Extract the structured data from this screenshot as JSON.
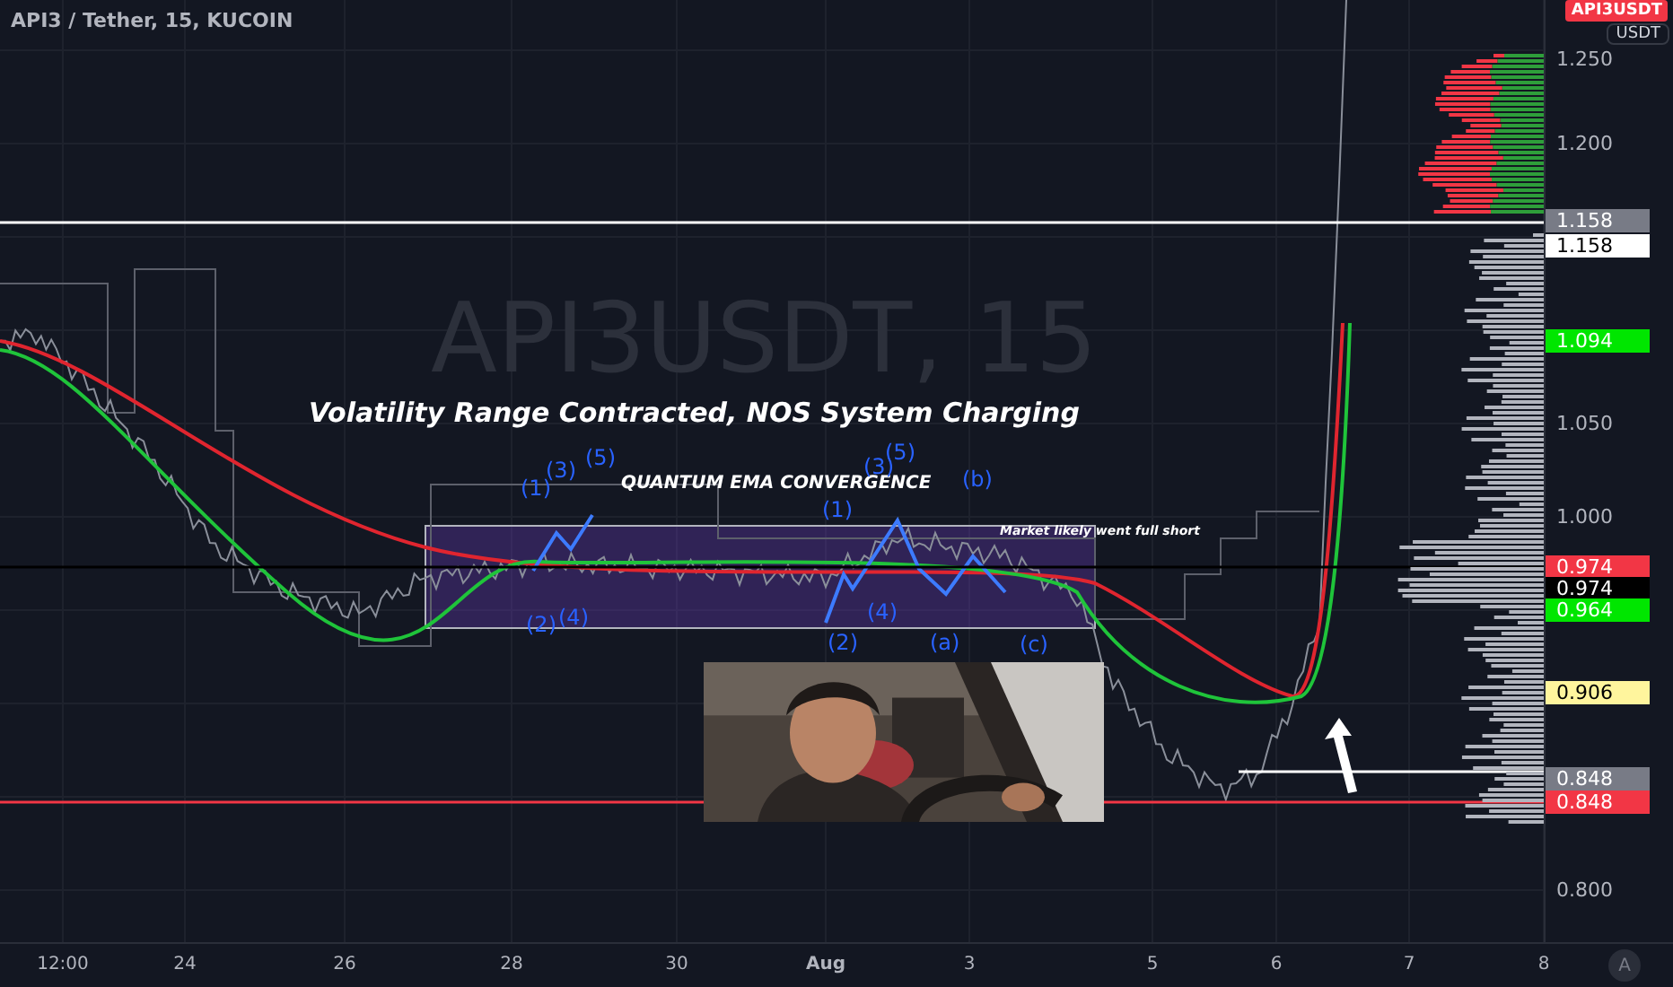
{
  "header": {
    "title": "API3 / Tether, 15, KUCOIN"
  },
  "watermark": "API3USDT, 15",
  "annotations": [
    {
      "kind": "headline",
      "text": "Volatility Range Contracted, NOS System Charging"
    },
    {
      "kind": "subtitle",
      "text": "QUANTUM EMA CONVERGENCE"
    },
    {
      "kind": "note",
      "text": "Market likely went full short"
    },
    {
      "kind": "wave",
      "text": "(1)"
    },
    {
      "kind": "wave",
      "text": "(3)"
    },
    {
      "kind": "wave",
      "text": "(5)"
    },
    {
      "kind": "wave",
      "text": "(3)"
    },
    {
      "kind": "wave",
      "text": "(5)"
    },
    {
      "kind": "wave",
      "text": "(b)"
    },
    {
      "kind": "wave",
      "text": "(1)"
    },
    {
      "kind": "wave",
      "text": "(2)"
    },
    {
      "kind": "wave",
      "text": "(4)"
    },
    {
      "kind": "wave",
      "text": "(4)"
    },
    {
      "kind": "wave",
      "text": "(2)"
    },
    {
      "kind": "wave",
      "text": "(a)"
    },
    {
      "kind": "wave",
      "text": "(c)"
    }
  ],
  "symbol_badge": "API3USDT",
  "currency_button": "USDT",
  "price_axis": [
    {
      "kind": "tick",
      "text": "1.250"
    },
    {
      "kind": "tick",
      "text": "1.200"
    },
    {
      "kind": "tag",
      "text": "1.158",
      "color": "#787b86"
    },
    {
      "kind": "tag",
      "text": "1.158",
      "color": "#ffffff"
    },
    {
      "kind": "tag",
      "text": "1.094",
      "color": "#00e600"
    },
    {
      "kind": "tick",
      "text": "1.050"
    },
    {
      "kind": "tick",
      "text": "1.000"
    },
    {
      "kind": "tag",
      "text": "0.974",
      "color": "#f23645"
    },
    {
      "kind": "tag",
      "text": "0.974",
      "color": "#000000"
    },
    {
      "kind": "tag",
      "text": "0.964",
      "color": "#00e600"
    },
    {
      "kind": "tag",
      "text": "0.906",
      "color": "#fff59d"
    },
    {
      "kind": "tag",
      "text": "0.848",
      "color": "#787b86"
    },
    {
      "kind": "tag",
      "text": "0.848",
      "color": "#f23645"
    },
    {
      "kind": "tick",
      "text": "0.800"
    }
  ],
  "time_axis": [
    {
      "kind": "time",
      "text": "12:00"
    },
    {
      "kind": "day",
      "text": "24"
    },
    {
      "kind": "day",
      "text": "26"
    },
    {
      "kind": "day",
      "text": "28"
    },
    {
      "kind": "day",
      "text": "30"
    },
    {
      "kind": "month",
      "text": "Aug"
    },
    {
      "kind": "day",
      "text": "3"
    },
    {
      "kind": "day",
      "text": "5"
    },
    {
      "kind": "day",
      "text": "6"
    },
    {
      "kind": "day",
      "text": "7"
    },
    {
      "kind": "day",
      "text": "8"
    }
  ],
  "auto_button": "A"
}
